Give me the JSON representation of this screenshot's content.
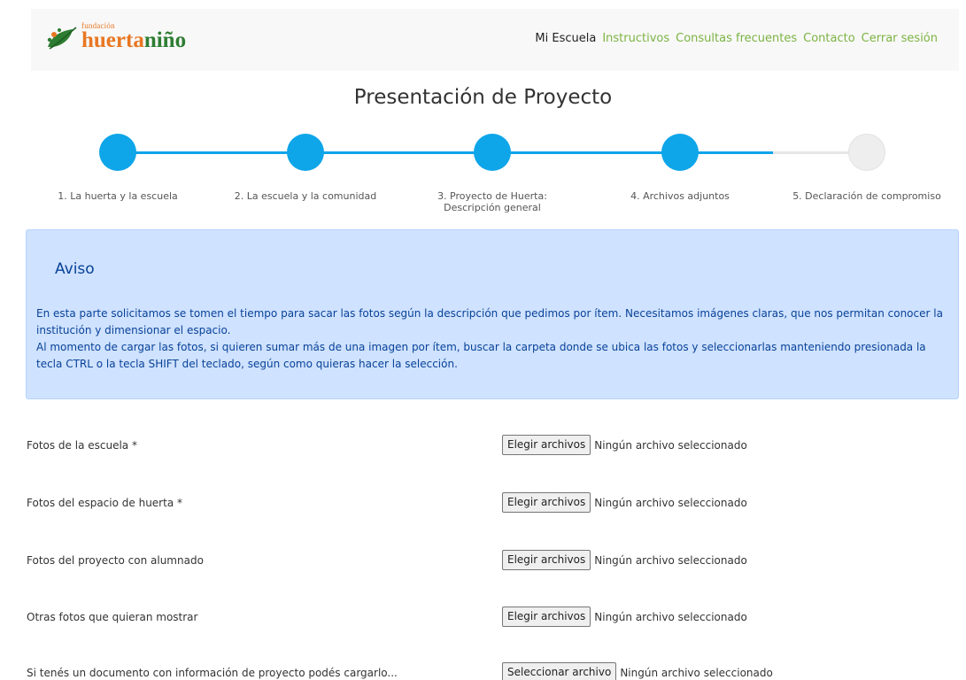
{
  "header": {
    "logo": {
      "small": "fundación",
      "part1": "huerta",
      "part2": "niño"
    },
    "nav": [
      "Mi Escuela",
      "Instructivos",
      "Consultas frecuentes",
      "Contacto",
      "Cerrar sesión"
    ]
  },
  "page": {
    "title": "Presentación de Proyecto"
  },
  "stepper": {
    "current_step": 4,
    "steps": [
      {
        "label": "1. La huerta y la escuela",
        "completed": true
      },
      {
        "label": "2. La escuela y la comunidad",
        "completed": true
      },
      {
        "label": "3. Proyecto de Huerta:",
        "label2": "Descripción general",
        "completed": true
      },
      {
        "label": "4. Archivos adjuntos",
        "completed": true
      },
      {
        "label": "5. Declaración de compromiso",
        "completed": false
      }
    ]
  },
  "alert": {
    "title": "Aviso",
    "paragraph1": "En esta parte solicitamos se tomen el tiempo para sacar las fotos según la descripción que pedimos por ítem. Necesitamos imágenes claras, que nos permitan conocer la institución y dimensionar el espacio.",
    "paragraph2": "Al momento de cargar las fotos, si quieren sumar más de una imagen por ítem, buscar la carpeta donde se ubica las fotos y seleccionarlas manteniendo presionada la tecla CTRL o la tecla SHIFT del teclado, según como quieras hacer la selección."
  },
  "fields": [
    {
      "label": "Fotos de la escuela *",
      "button": "Elegir archivos",
      "status": "Ningún archivo seleccionado"
    },
    {
      "label": "Fotos del espacio de huerta *",
      "button": "Elegir archivos",
      "status": "Ningún archivo seleccionado"
    },
    {
      "label": "Fotos del proyecto con alumnado",
      "button": "Elegir archivos",
      "status": "Ningún archivo seleccionado"
    },
    {
      "label": "Otras fotos que quieran mostrar",
      "button": "Elegir archivos",
      "status": "Ningún archivo seleccionado"
    },
    {
      "label": "Si tenés un documento con información de proyecto podés cargarlo...",
      "button": "Seleccionar archivo",
      "status": "Ningún archivo seleccionado"
    }
  ],
  "colors": {
    "step_active": "#0ea5e9",
    "step_inactive": "#eeeeee",
    "nav_link": "#7cb342",
    "alert_bg": "#cfe2ff",
    "alert_text": "#084298"
  }
}
